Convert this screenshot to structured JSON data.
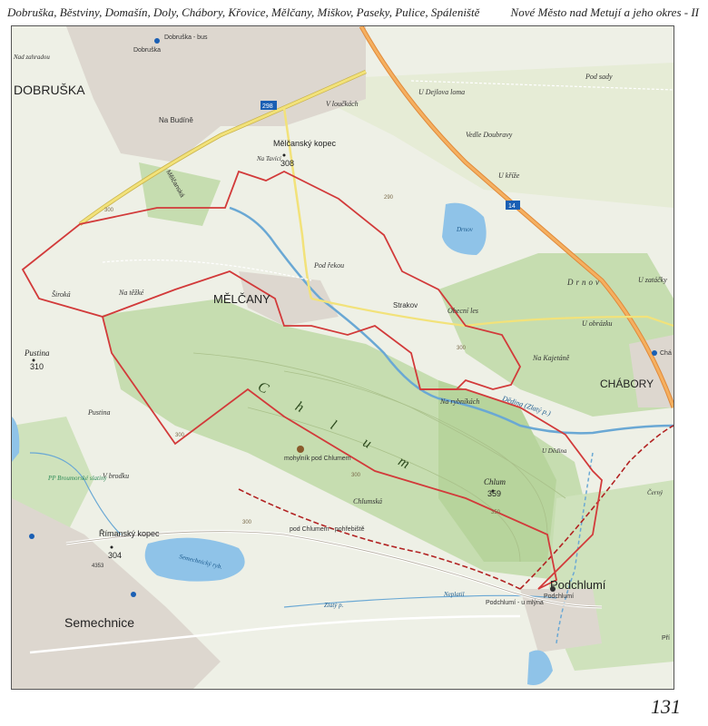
{
  "header": {
    "places": "Dobruška, Běstviny, Domašín, Doly, Chábory, Křovice, Mělčany, Miškov, Paseky, Pulice, Spáleniště",
    "region": "Nové Město nad Metují a jeho okres - II"
  },
  "page_number": "131",
  "map": {
    "colors": {
      "background": "#eef0e6",
      "forest": "#c6ddb0",
      "forest_dark": "#b7d49c",
      "meadow": "#e3ead0",
      "urban": "#d9d3cc",
      "water": "#8fc3e8",
      "boundary": "#d23a3a",
      "main_road": "#f2e27a",
      "highway": "#f2a54a",
      "stream": "#6aa8d4",
      "trail_red": "#c0272d",
      "trail_green": "#2e8b57"
    },
    "towns": {
      "dobruska": "DOBRUŠKA",
      "melcany": "MĚLČANY",
      "chabory": "CHÁBORY",
      "semechnice": "Semechnice",
      "podchlumi": "Podchlumí"
    },
    "peaks": {
      "melcansky_kopec_name": "Mělčanský kopec",
      "melcansky_kopec_alt": "308",
      "pustina_name": "Pustina",
      "pustina_alt": "310",
      "rimansky_kopec_name": "Římanský kopec",
      "rimansky_kopec_alt": "304",
      "chlum_name": "Chlum",
      "chlum_alt": "359"
    },
    "forest_name": "C h l u m",
    "labels": {
      "pod_sady": "Pod sady",
      "u_dejlova_loma": "U Dejlova loma",
      "v_louckach": "V loučkách",
      "vedle_doubravy": "Vedle Doubravy",
      "u_krize": "U kříže",
      "drnov": "Drnov",
      "drnov_lake": "Drnov",
      "u_zatacky": "U zatáčky",
      "u_obrazku": "U obrázku",
      "na_kajetane": "Na Kajetáně",
      "obecni_les": "Obecní les",
      "strakov": "Strakov",
      "pod_rekou": "Pod řekou",
      "na_tezke": "Na těžké",
      "siroka": "Široká",
      "pustina_area": "Pustina",
      "na_rybnikach": "Na rybníkách",
      "dedina": "Dědina (Zlatý p.)",
      "u_dedina": "U Dědina",
      "na_budine": "Na Budíně",
      "na_tavici": "Na Tavíci",
      "nad_zahradou": "Nad zahradou",
      "melcanska": "Mělčanská",
      "v_brodku": "V brodku",
      "pp_broumovske": "PP Broumorské slatiny",
      "chlumska": "Chlumská",
      "mohylnik": "mohylník pod Chlumem",
      "pod_chlumem_pohrebiste": "pod Chlumem - pohřebiště",
      "semechnicky_ryb": "Semechnický ryb.",
      "podchlumi_u_mlyna": "Podchlumí - u mlýna",
      "podchlumi_stop": "Podchlumí",
      "neplatil": "Neplatil",
      "zlaty_p": "Zlatý p.",
      "dobruska_bus": "Dobruška - bus",
      "dobruska_stop": "Dobruška",
      "cerny": "Černý",
      "pri": "Pří",
      "chabory_stop": "Chá"
    },
    "road_numbers": {
      "r298": "298",
      "r14": "14",
      "r4353": "4353"
    },
    "contours": {
      "c300a": "300",
      "c300b": "300",
      "c300c": "300",
      "c300d": "300",
      "c300e": "300",
      "c350": "350",
      "c290": "290"
    }
  }
}
